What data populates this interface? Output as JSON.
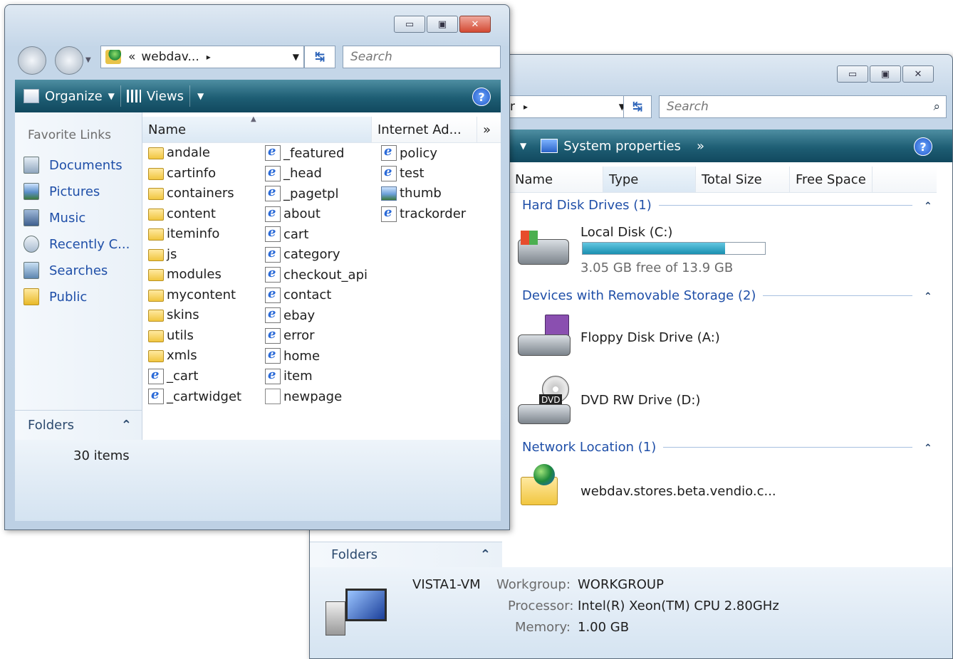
{
  "win_back": {
    "caption_buttons": [
      "minimize",
      "maximize",
      "close"
    ],
    "address_tail": "r",
    "search_placeholder": "Search",
    "toolbar": {
      "system_properties": "System properties",
      "more": "»"
    },
    "columns": [
      "Name",
      "Type",
      "Total Size",
      "Free Space"
    ],
    "groups": [
      {
        "label": "Hard Disk Drives (1)"
      },
      {
        "label": "Devices with Removable Storage (2)"
      },
      {
        "label": "Network Location (1)"
      }
    ],
    "drives": {
      "local": {
        "name": "Local Disk (C:)",
        "free_text": "3.05 GB free of 13.9 GB",
        "used_fraction": 0.78
      },
      "floppy": {
        "name": "Floppy Disk Drive (A:)"
      },
      "dvd": {
        "name": "DVD RW Drive (D:)",
        "badge": "DVD"
      },
      "network": {
        "name": "webdav.stores.beta.vendio.c..."
      }
    },
    "folders_label": "Folders",
    "details": {
      "computer_name": "VISTA1-VM",
      "workgroup_label": "Workgroup:",
      "workgroup_value": "WORKGROUP",
      "processor_label": "Processor:",
      "processor_value": "Intel(R) Xeon(TM) CPU 2.80GHz",
      "memory_label": "Memory:",
      "memory_value": "1.00 GB"
    }
  },
  "win_front": {
    "address": {
      "chevrons": "«",
      "path": "webdav...",
      "arrow": "▸"
    },
    "search_placeholder": "Search",
    "toolbar": {
      "organize": "Organize",
      "views": "Views"
    },
    "nav": {
      "header": "Favorite Links",
      "items": [
        "Documents",
        "Pictures",
        "Music",
        "Recently C...",
        "Searches",
        "Public"
      ]
    },
    "columns": {
      "name": "Name",
      "internet_address": "Internet Ad...",
      "more": "»"
    },
    "files_col1": [
      {
        "name": "andale",
        "type": "folder"
      },
      {
        "name": "cartinfo",
        "type": "folder"
      },
      {
        "name": "containers",
        "type": "folder"
      },
      {
        "name": "content",
        "type": "folder"
      },
      {
        "name": "iteminfo",
        "type": "folder"
      },
      {
        "name": "js",
        "type": "folder"
      },
      {
        "name": "modules",
        "type": "folder"
      },
      {
        "name": "mycontent",
        "type": "folder"
      },
      {
        "name": "skins",
        "type": "folder"
      },
      {
        "name": "utils",
        "type": "folder"
      },
      {
        "name": "xmls",
        "type": "folder"
      },
      {
        "name": "_cart",
        "type": "ie"
      },
      {
        "name": "_cartwidget",
        "type": "ie"
      }
    ],
    "files_col2": [
      {
        "name": "_featured",
        "type": "ie"
      },
      {
        "name": "_head",
        "type": "ie"
      },
      {
        "name": "_pagetpl",
        "type": "ie"
      },
      {
        "name": "about",
        "type": "ie"
      },
      {
        "name": "cart",
        "type": "ie"
      },
      {
        "name": "category",
        "type": "ie"
      },
      {
        "name": "checkout_api",
        "type": "ie"
      },
      {
        "name": "contact",
        "type": "ie"
      },
      {
        "name": "ebay",
        "type": "ie"
      },
      {
        "name": "error",
        "type": "ie"
      },
      {
        "name": "home",
        "type": "ie"
      },
      {
        "name": "item",
        "type": "ie"
      },
      {
        "name": "newpage",
        "type": "blank"
      }
    ],
    "files_col3": [
      {
        "name": "policy",
        "type": "ie"
      },
      {
        "name": "test",
        "type": "ie"
      },
      {
        "name": "thumb",
        "type": "img"
      },
      {
        "name": "trackorder",
        "type": "ie"
      }
    ],
    "folders_label": "Folders",
    "status": "30 items"
  },
  "colors": {
    "toolbar": "#1e5e74",
    "link": "#1f4fa8",
    "progress": "#1a8fb0"
  }
}
